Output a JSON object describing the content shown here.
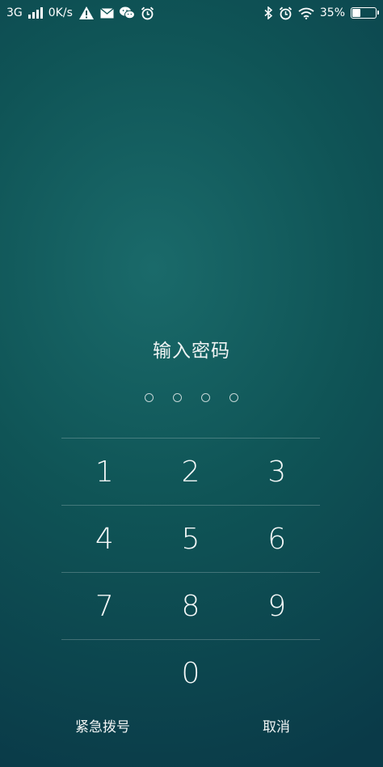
{
  "status_bar": {
    "network_type": "3G",
    "data_speed": "0K/s",
    "battery_percent": "35%",
    "battery_level": 0.35,
    "left_icons": [
      "signal-icon",
      "warning-icon",
      "mail-icon",
      "wechat-icon",
      "alarm-icon"
    ],
    "right_icons": [
      "bluetooth-icon",
      "alarm-icon",
      "wifi-icon",
      "battery-icon"
    ]
  },
  "lockscreen": {
    "prompt": "输入密码",
    "pin_length": 4,
    "keys": [
      [
        "1",
        "2",
        "3"
      ],
      [
        "4",
        "5",
        "6"
      ],
      [
        "7",
        "8",
        "9"
      ],
      [
        "",
        "0",
        ""
      ]
    ],
    "emergency_label": "紧急拨号",
    "cancel_label": "取消"
  },
  "colors": {
    "background_top": "#1a6a6a",
    "background_bottom": "#0a3a48",
    "text": "#ffffff"
  }
}
